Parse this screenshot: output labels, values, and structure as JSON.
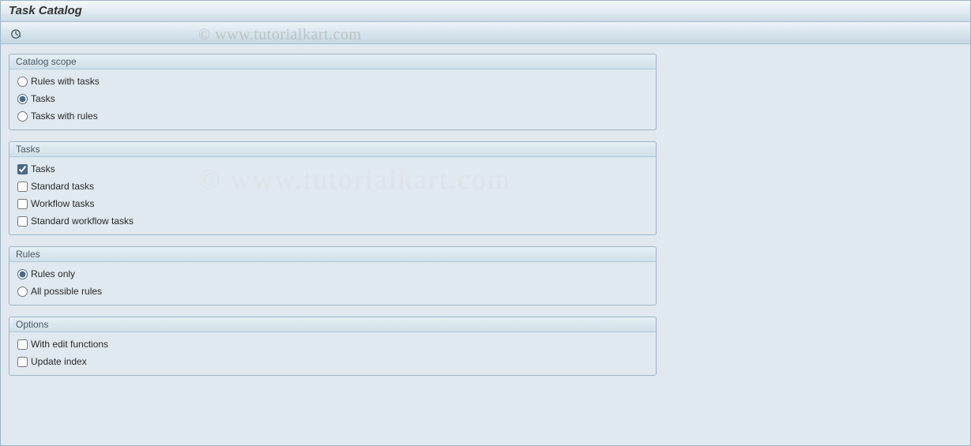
{
  "title": "Task Catalog",
  "watermark": "© www.tutorialkart.com",
  "toolbar": {
    "execute_tooltip": "Execute"
  },
  "groups": {
    "scope": {
      "title": "Catalog scope",
      "options": {
        "rules_with_tasks": "Rules with tasks",
        "tasks": "Tasks",
        "tasks_with_rules": "Tasks with rules"
      },
      "selected": "tasks"
    },
    "tasks": {
      "title": "Tasks",
      "options": {
        "tasks": "Tasks",
        "standard_tasks": "Standard tasks",
        "workflow_tasks": "Workflow tasks",
        "standard_workflow_tasks": "Standard workflow tasks"
      },
      "checked": {
        "tasks": true,
        "standard_tasks": false,
        "workflow_tasks": false,
        "standard_workflow_tasks": false
      }
    },
    "rules": {
      "title": "Rules",
      "options": {
        "rules_only": "Rules only",
        "all_possible_rules": "All possible rules"
      },
      "selected": "rules_only"
    },
    "options": {
      "title": "Options",
      "options": {
        "with_edit_functions": "With edit functions",
        "update_index": "Update index"
      },
      "checked": {
        "with_edit_functions": false,
        "update_index": false
      }
    }
  }
}
